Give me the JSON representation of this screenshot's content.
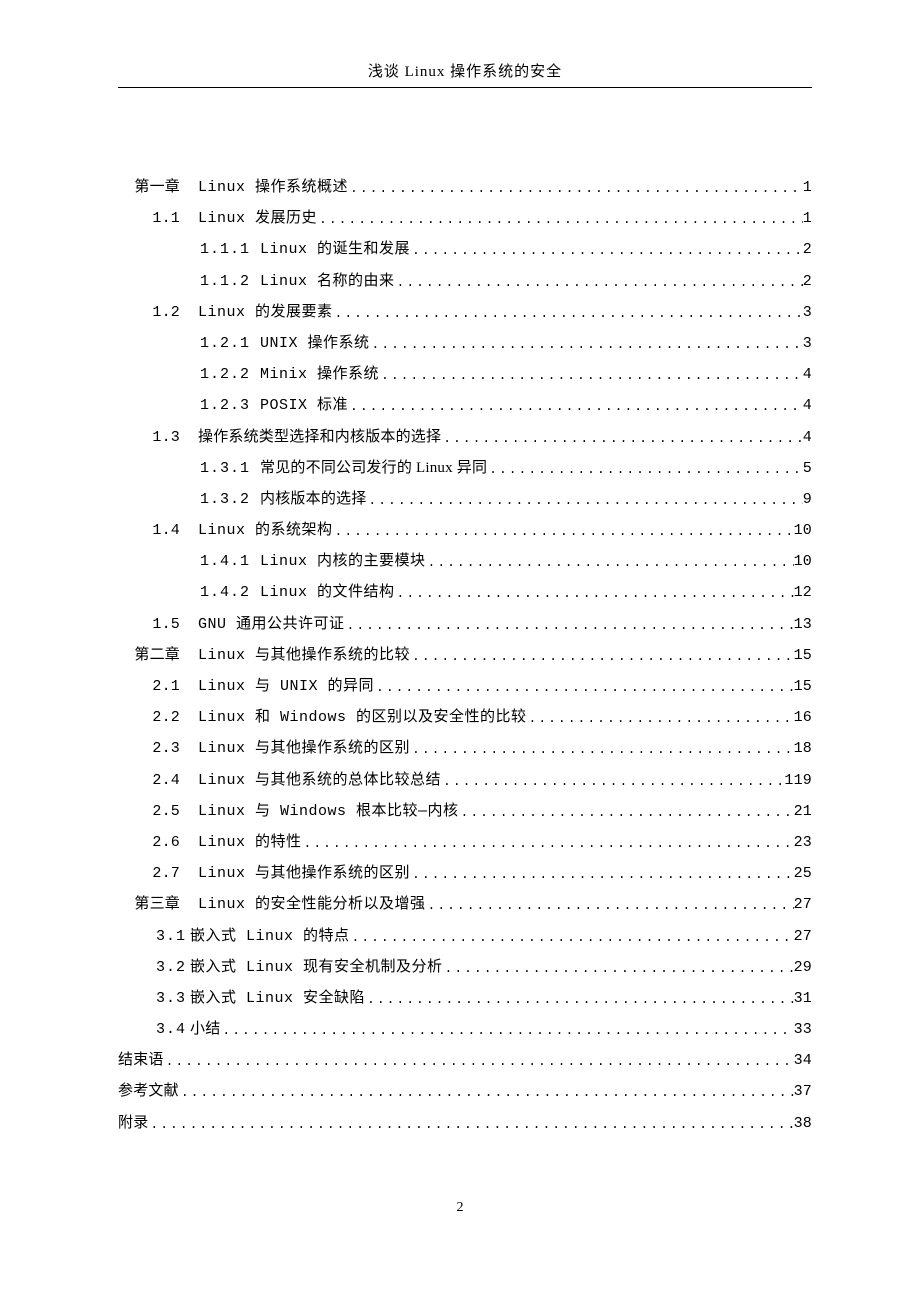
{
  "header": {
    "title": "浅谈 Linux 操作系统的安全"
  },
  "page_number": "2",
  "toc": {
    "ch1": {
      "num": "第一章",
      "title": "Linux 操作系统概述",
      "page": "1"
    },
    "s11": {
      "num": "1.1",
      "title": "Linux 发展历史",
      "page": "1"
    },
    "s111": {
      "num": "1.1.1",
      "title": "Linux 的诞生和发展",
      "page": "2"
    },
    "s112": {
      "num": "1.1.2",
      "title": "Linux 名称的由来",
      "page": "2"
    },
    "s12": {
      "num": "1.2",
      "title": "Linux 的发展要素",
      "page": "3"
    },
    "s121": {
      "num": "1.2.1",
      "title": "UNIX 操作系统",
      "page": "3"
    },
    "s122": {
      "num": "1.2.2",
      "title": "Minix 操作系统",
      "page": "4"
    },
    "s123": {
      "num": "1.2.3",
      "title": "POSIX 标准",
      "page": "4"
    },
    "s13": {
      "num": "1.3",
      "title": "操作系统类型选择和内核版本的选择",
      "page": "4"
    },
    "s131": {
      "num": "1.3.1",
      "title": "常见的不同公司发行的 Linux 异同",
      "page": "5"
    },
    "s132": {
      "num": "1.3.2",
      "title": "内核版本的选择",
      "page": "9"
    },
    "s14": {
      "num": "1.4",
      "title": "Linux 的系统架构",
      "page": "10"
    },
    "s141": {
      "num": "1.4.1",
      "title": "Linux 内核的主要模块",
      "page": "10"
    },
    "s142": {
      "num": "1.4.2",
      "title": "Linux 的文件结构",
      "page": "12"
    },
    "s15": {
      "num": "1.5",
      "title": "GNU 通用公共许可证",
      "page": "13"
    },
    "ch2": {
      "num": "第二章",
      "title": "Linux 与其他操作系统的比较",
      "page": "15"
    },
    "s21": {
      "num": "2.1",
      "title": "Linux 与 UNIX 的异同",
      "page": "15"
    },
    "s22": {
      "num": "2.2",
      "title": "Linux 和 Windows 的区别以及安全性的比较",
      "page": "16"
    },
    "s23": {
      "num": "2.3",
      "title": "Linux 与其他操作系统的区别",
      "page": "18"
    },
    "s24": {
      "num": "2.4",
      "title": "Linux 与其他系统的总体比较总结",
      "page": "119"
    },
    "s25": {
      "num": "2.5",
      "title": "Linux 与 Windows 根本比较—内核",
      "page": "21"
    },
    "s26": {
      "num": "2.6",
      "title": "Linux 的特性",
      "page": "23"
    },
    "s27": {
      "num": "2.7",
      "title": "Linux 与其他操作系统的区别",
      "page": "25"
    },
    "ch3": {
      "num": "第三章",
      "title": "Linux 的安全性能分析以及增强",
      "page": "27"
    },
    "s31": {
      "num": "3.1",
      "title": "嵌入式 Linux 的特点",
      "page": "27"
    },
    "s32": {
      "num": "3.2",
      "title": "嵌入式 Linux 现有安全机制及分析",
      "page": "29"
    },
    "s33": {
      "num": "3.3",
      "title": "嵌入式 Linux 安全缺陷",
      "page": "31"
    },
    "s34": {
      "num": "3.4",
      "title": "小结",
      "page": "33"
    },
    "end": {
      "title": "结束语",
      "page": "34"
    },
    "ref": {
      "title": "参考文献",
      "page": "37"
    },
    "app": {
      "title": "附录",
      "page": "38"
    }
  }
}
